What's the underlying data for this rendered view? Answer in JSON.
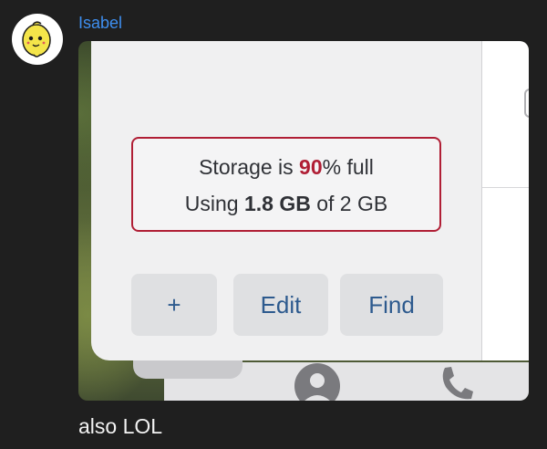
{
  "message": {
    "sender_name": "Isabel",
    "text": "also LOL"
  },
  "avatar": {
    "icon": "lemon-face-icon",
    "background": "#ffffff",
    "fill": "#f4e54a"
  },
  "screenshot": {
    "storage": {
      "prefix": "Storage is ",
      "percent": "90",
      "suffix": "% full",
      "using_prefix": "Using ",
      "used": "1.8 GB",
      "of_label": " of 2 GB"
    },
    "buttons": {
      "add_label": "+",
      "edit_label": "Edit",
      "find_label": "Find"
    },
    "bottom_nav_icons": [
      "person-icon",
      "phone-icon",
      "blue-dot-icon"
    ]
  },
  "colors": {
    "sender": "#3e8ff0",
    "warning": "#b01e35",
    "button_text": "#2d5a8e",
    "background": "#1f1f1f"
  }
}
